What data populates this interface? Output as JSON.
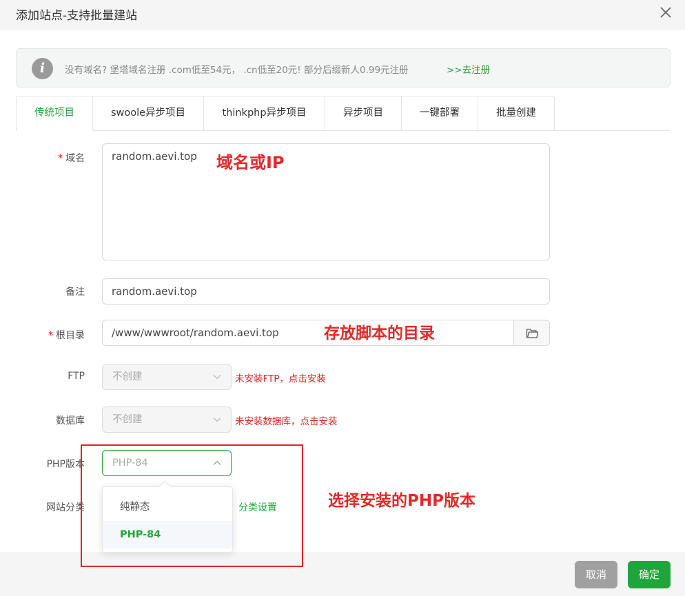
{
  "dialog": {
    "title": "添加站点-支持批量建站"
  },
  "banner": {
    "text": "没有域名? 堡塔域名注册 .com低至54元， .cn低至20元! 部分后缀新人0.99元注册",
    "link": ">>去注册"
  },
  "tabs": [
    {
      "label": "传统项目",
      "active": true
    },
    {
      "label": "swoole异步项目"
    },
    {
      "label": "thinkphp异步项目"
    },
    {
      "label": "异步项目"
    },
    {
      "label": "一键部署"
    },
    {
      "label": "批量创建"
    }
  ],
  "form": {
    "domain": {
      "label": "域名",
      "value": "random.aevi.top"
    },
    "remark": {
      "label": "备注",
      "value": "random.aevi.top"
    },
    "root": {
      "label": "根目录",
      "value": "/www/wwwroot/random.aevi.top"
    },
    "ftp": {
      "label": "FTP",
      "value": "不创建",
      "hint": "未安装FTP，点击安装"
    },
    "database": {
      "label": "数据库",
      "value": "不创建",
      "hint": "未安装数据库，点击安装"
    },
    "php": {
      "label": "PHP版本",
      "value": "PHP-84",
      "options": [
        "纯静态",
        "PHP-84"
      ],
      "selected": "PHP-84"
    },
    "category": {
      "label": "网站分类",
      "link": "分类设置"
    }
  },
  "annotations": {
    "domain_note": "域名或IP",
    "root_note": "存放脚本的目录",
    "php_note": "选择安装的PHP版本"
  },
  "footer": {
    "cancel": "取消",
    "confirm": "确定"
  },
  "colors": {
    "accent": "#20a53a",
    "warning": "#e02020",
    "annotation": "#e52828"
  }
}
